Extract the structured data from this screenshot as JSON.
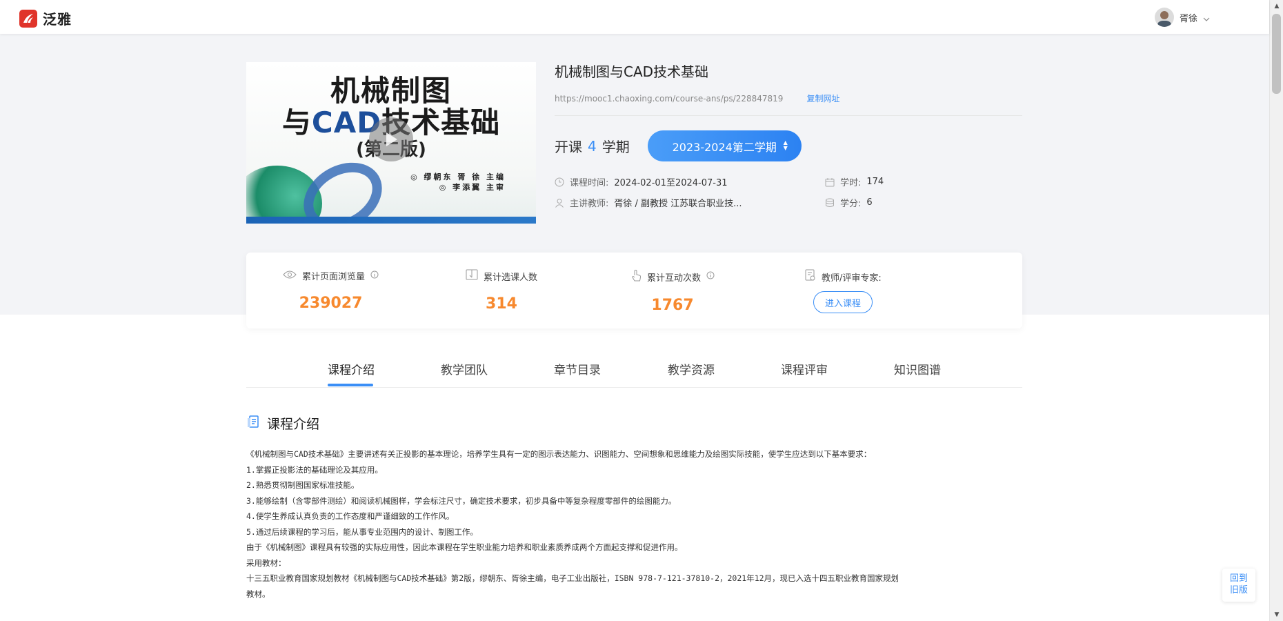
{
  "header": {
    "brand": "泛雅",
    "user_name": "胥徐",
    "colors": {
      "brand": "#e0342a"
    }
  },
  "course": {
    "title": "机械制图与CAD技术基础",
    "url": "https://mooc1.chaoxing.com/course-ans/ps/228847819",
    "copy_label": "复制网址",
    "cover": {
      "line1": "机械制图",
      "line2_prefix": "与",
      "line2_blue": "CAD",
      "line2_suffix": "技术基础",
      "edition": "(第二版)",
      "author": "◎ 缪朝东  胥 徐  主编",
      "reviewer": "◎ 李添翼  主审"
    },
    "terms": {
      "label_prefix": "开课",
      "count": "4",
      "label_suffix": "学期",
      "selected": "2023-2024第二学期"
    },
    "meta": {
      "time_label": "课程时间:",
      "time_value": "2024-02-01至2024-07-31",
      "hours_label": "学时:",
      "hours_value": "174",
      "teacher_label": "主讲教师:",
      "teacher_value": "胥徐 / 副教授 江苏联合职业技...",
      "credit_label": "学分:",
      "credit_value": "6"
    }
  },
  "stats": {
    "views_label": "累计页面浏览量",
    "views_value": "239027",
    "enroll_label": "累计选课人数",
    "enroll_value": "314",
    "interact_label": "累计互动次数",
    "interact_value": "1767",
    "expert_label": "教师/评审专家:",
    "enter_label": "进入课程",
    "colors": {
      "number": "#f7892e",
      "accent": "#3a8ef6"
    }
  },
  "tabs": [
    {
      "label": "课程介绍",
      "active": true
    },
    {
      "label": "教学团队",
      "active": false
    },
    {
      "label": "章节目录",
      "active": false
    },
    {
      "label": "教学资源",
      "active": false
    },
    {
      "label": "课程评审",
      "active": false
    },
    {
      "label": "知识图谱",
      "active": false
    }
  ],
  "intro": {
    "title": "课程介绍",
    "paragraphs": [
      "  《机械制图与CAD技术基础》主要讲述有关正投影的基本理论，培养学生具有一定的图示表达能力、识图能力、空间想象和思维能力及绘图实际技能，使学生应达到以下基本要求：",
      "1.掌握正投影法的基础理论及其应用。",
      "2.熟悉贯彻制图国家标准技能。",
      "3.能够绘制（含零部件测绘）和阅读机械图样，学会标注尺寸，确定技术要求，初步具备中等复杂程度零部件的绘图能力。",
      "4.使学生养成认真负责的工作态度和严谨细致的工作作风。",
      "5.通过后续课程的学习后，能从事专业范围内的设计、制图工作。",
      "    由于《机械制图》课程具有较强的实际应用性，因此本课程在学生职业能力培养和职业素质养成两个方面起支撑和促进作用。",
      "采用教材：",
      "  十三五职业教育国家规划教材《机械制图与CAD技术基础》第2版，缪朝东、胥徐主编，电子工业出版社，ISBN 978-7-121-37810-2，2021年12月，现已入选十四五职业教育国家规划",
      "教材。"
    ]
  },
  "float": {
    "line1": "回到",
    "line2": "旧版"
  }
}
